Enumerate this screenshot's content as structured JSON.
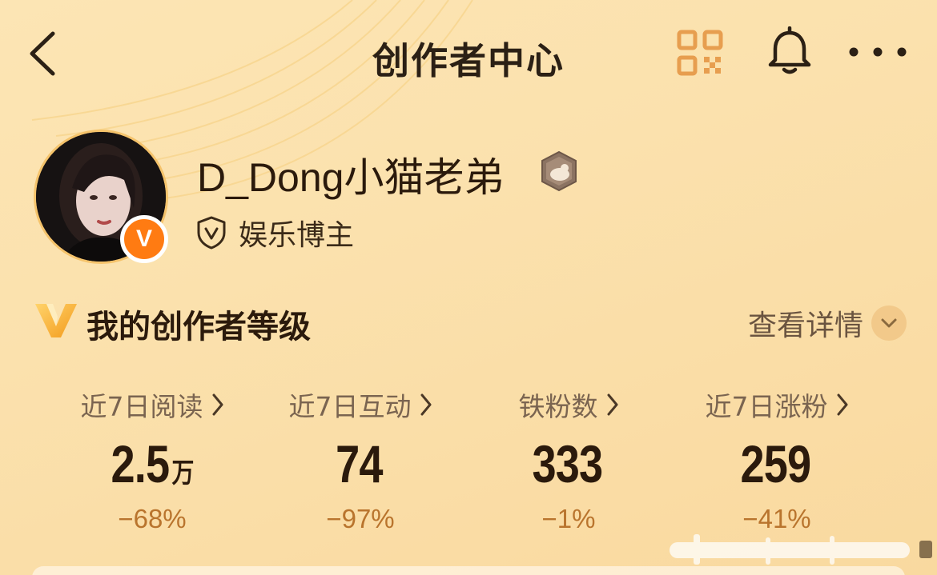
{
  "header": {
    "title": "创作者中心",
    "back_icon": "back-chevron-icon",
    "qr_icon": "qr-code-icon",
    "bell_icon": "bell-icon",
    "more_icon": "more-dots-icon"
  },
  "profile": {
    "username": "D_Dong小猫老弟",
    "verified_badge": "V",
    "role": "娱乐博主"
  },
  "section": {
    "title": "我的创作者等级",
    "detail_label": "查看详情"
  },
  "stats": [
    {
      "label": "近7日阅读",
      "value": "2.5",
      "unit": "万",
      "change": "−68%"
    },
    {
      "label": "近7日互动",
      "value": "74",
      "unit": "",
      "change": "−97%"
    },
    {
      "label": "铁粉数",
      "value": "333",
      "unit": "",
      "change": "−1%"
    },
    {
      "label": "近7日涨粉",
      "value": "259",
      "unit": "",
      "change": "−41%"
    }
  ],
  "colors": {
    "accent_orange": "#ff7b12",
    "change_text": "#b9742d",
    "background": "#fce5b4"
  }
}
